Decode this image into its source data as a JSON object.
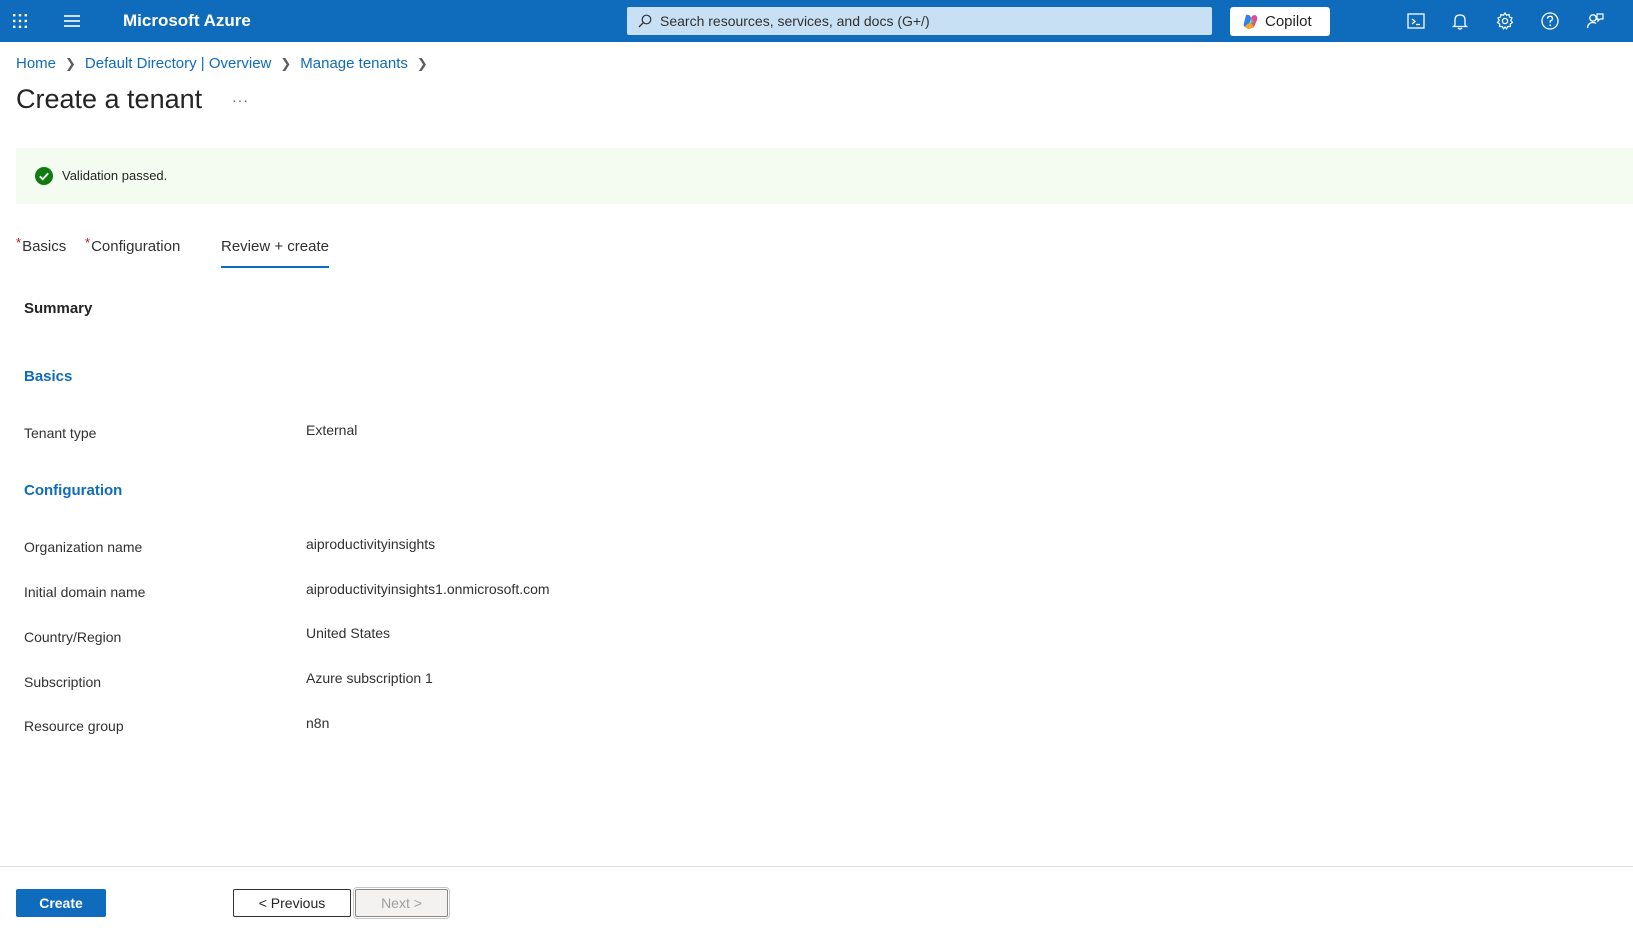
{
  "app": {
    "brand": "Microsoft Azure"
  },
  "search": {
    "placeholder": "Search resources, services, and docs (G+/)"
  },
  "copilot": {
    "label": "Copilot"
  },
  "breadcrumb": [
    "Home",
    "Default Directory | Overview",
    "Manage tenants"
  ],
  "page": {
    "title": "Create a tenant",
    "more": "···"
  },
  "validation": {
    "text": "Validation passed."
  },
  "tabs": [
    {
      "label": "Basics",
      "required": true
    },
    {
      "label": "Configuration",
      "required": true
    },
    {
      "label": "Review + create",
      "required": false,
      "active": true
    }
  ],
  "summary": {
    "heading": "Summary",
    "basics": {
      "heading": "Basics",
      "rows": [
        {
          "label": "Tenant type",
          "value": "External"
        }
      ]
    },
    "configuration": {
      "heading": "Configuration",
      "rows": [
        {
          "label": "Organization name",
          "value": "aiproductivityinsights"
        },
        {
          "label": "Initial domain name",
          "value": "aiproductivityinsights1.onmicrosoft.com"
        },
        {
          "label": "Country/Region",
          "value": "United States"
        },
        {
          "label": "Subscription",
          "value": "Azure subscription 1"
        },
        {
          "label": "Resource group",
          "value": "n8n"
        }
      ]
    }
  },
  "footer": {
    "create": "Create",
    "previous": "< Previous",
    "next": "Next >"
  },
  "icons": {
    "topbar_right": [
      "cloud-shell-icon",
      "notifications-bell-icon",
      "settings-gear-icon",
      "help-question-icon",
      "feedback-icon"
    ]
  },
  "colors": {
    "accent": "#0f6cbd",
    "success": "#107c10",
    "validation_bg": "#f4fbf0",
    "required": "#c50f1f"
  }
}
